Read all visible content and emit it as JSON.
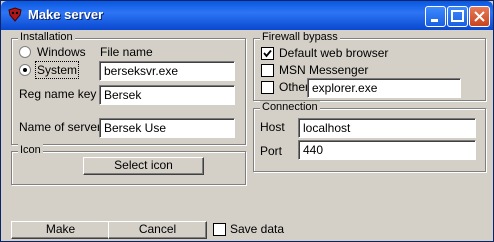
{
  "window": {
    "title": "Make server"
  },
  "installation": {
    "group_label": "Installation",
    "radio_windows": "Windows",
    "radio_system": "System",
    "selected": "System",
    "file_name_label": "File name",
    "file_name_value": "berseksvr.exe",
    "reg_name_label": "Reg name key",
    "reg_name_value": "Bersek",
    "server_name_label": "Name of server",
    "server_name_value": "Bersek Use"
  },
  "icon_group": {
    "group_label": "Icon",
    "select_button": "Select icon"
  },
  "firewall": {
    "group_label": "Firewall bypass",
    "default_browser_label": "Default web browser",
    "default_browser_checked": true,
    "msn_label": "MSN Messenger",
    "msn_checked": false,
    "other_label": "Other",
    "other_checked": false,
    "other_value": "explorer.exe"
  },
  "connection": {
    "group_label": "Connection",
    "host_label": "Host",
    "host_value": "localhost",
    "port_label": "Port",
    "port_value": "440"
  },
  "footer": {
    "make_button": "Make",
    "cancel_button": "Cancel",
    "save_label": "Save data",
    "save_checked": false
  }
}
